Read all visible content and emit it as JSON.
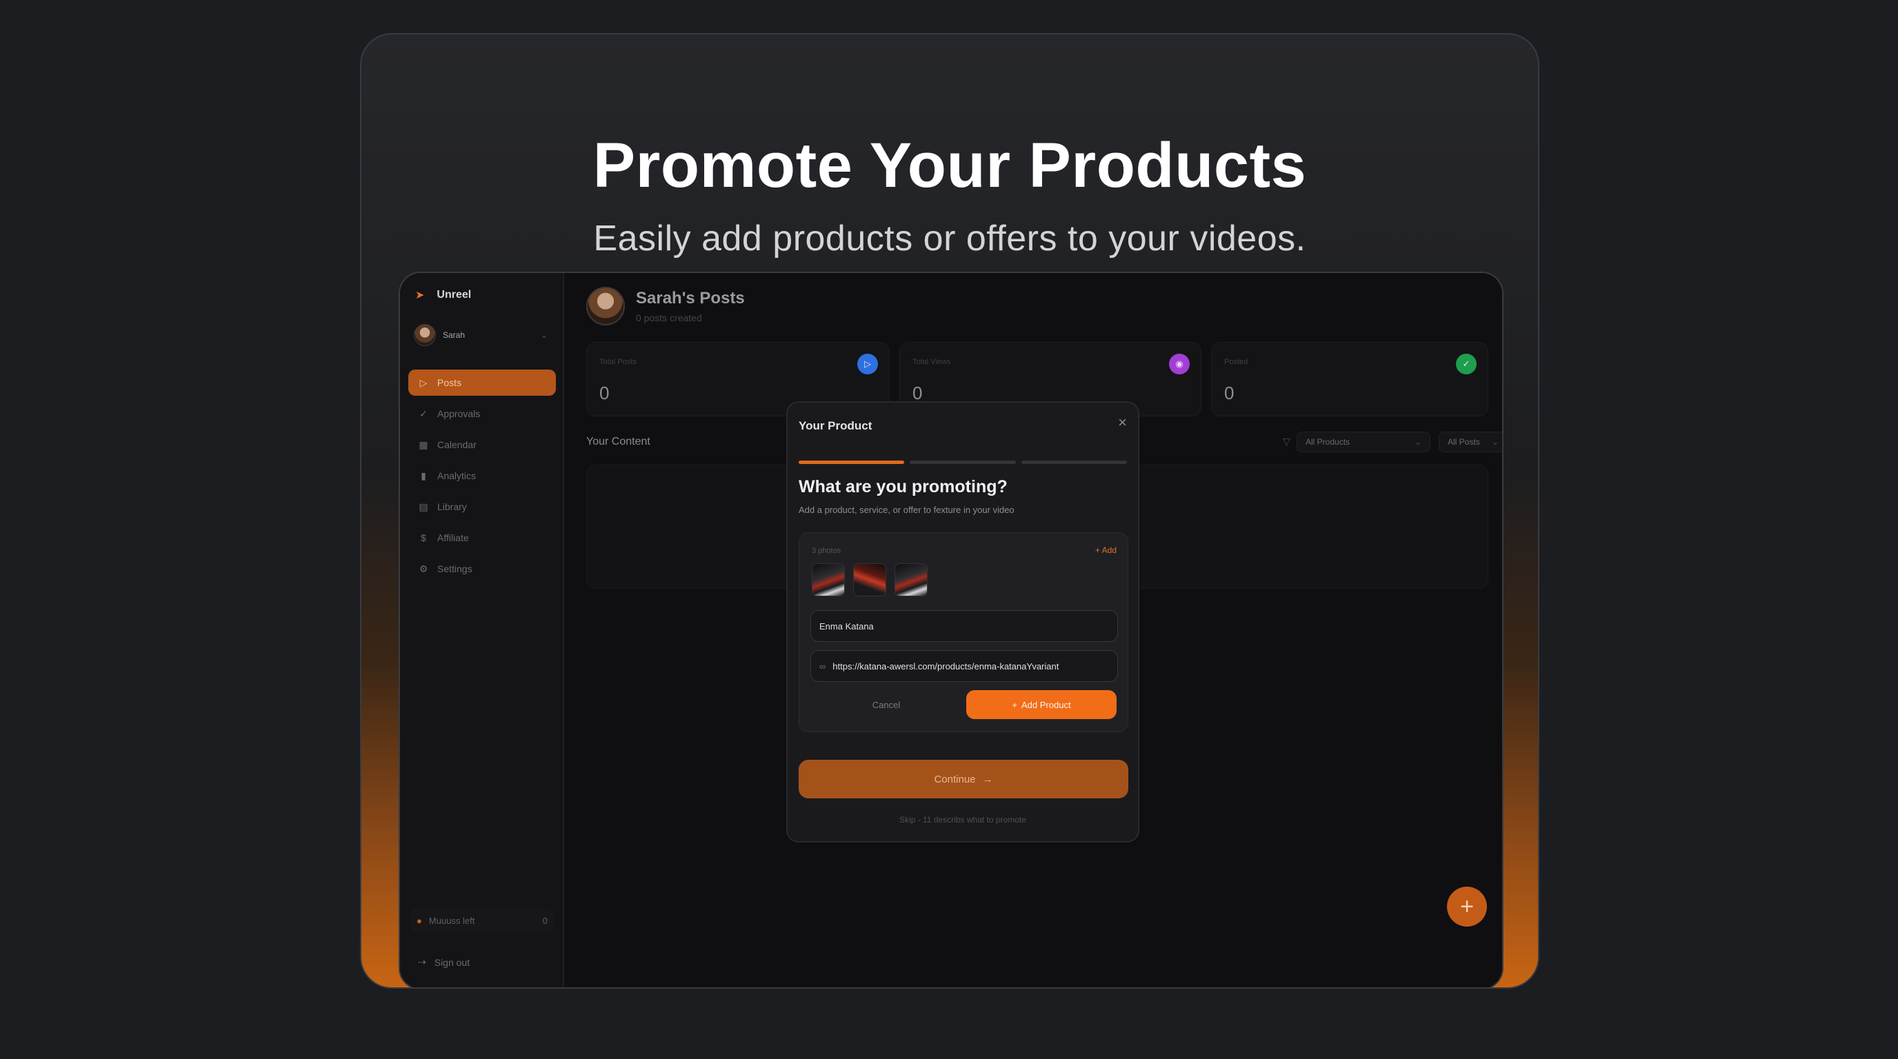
{
  "hero": {
    "title": "Promote Your Products",
    "subtitle": "Easily add products or offers to your videos."
  },
  "sidebar": {
    "brand": "Unreel",
    "user_name": "Sarah",
    "items": [
      {
        "label": "Posts",
        "icon": "play-icon",
        "active": true
      },
      {
        "label": "Approvals",
        "icon": "check-circle-icon",
        "active": false
      },
      {
        "label": "Calendar",
        "icon": "calendar-icon",
        "active": false
      },
      {
        "label": "Analytics",
        "icon": "bar-chart-icon",
        "active": false
      },
      {
        "label": "Library",
        "icon": "book-icon",
        "active": false
      },
      {
        "label": "Affiliate",
        "icon": "dollar-icon",
        "active": false
      },
      {
        "label": "Settings",
        "icon": "gear-icon",
        "active": false
      }
    ],
    "credits_label": "Muuuss left",
    "credits_value": "0",
    "sign_out": "Sign out"
  },
  "header": {
    "title": "Sarah's Posts",
    "subtitle": "0 posts created"
  },
  "stats": [
    {
      "label": "Total Posts",
      "value": "0",
      "icon": "play-icon",
      "color": "#2f6fe0"
    },
    {
      "label": "Total Views",
      "value": "0",
      "icon": "eye-icon",
      "color": "#a23fd6"
    },
    {
      "label": "Posted",
      "value": "0",
      "icon": "check-icon",
      "color": "#1e9e4e"
    }
  ],
  "content": {
    "label": "Your Content",
    "filter_products": "All Products",
    "filter_posts": "All Posts"
  },
  "modal": {
    "title": "Your Product",
    "heading": "What are you promoting?",
    "description": "Add a product, service, or offer to fexture in your video",
    "photos_label": "3 photos",
    "add_label": "+ Add",
    "product_name": "Enma Katana",
    "product_url": "https://katana-awersl.com/products/enma-katanaYvariant",
    "cancel": "Cancel",
    "add_product": "Add Product",
    "continue": "Continue",
    "skip_text": "Skip - 11 describs what to promote",
    "progress_steps": 3,
    "progress_current": 1
  },
  "colors": {
    "accent": "#f26d18",
    "background": "#1c1d21"
  }
}
